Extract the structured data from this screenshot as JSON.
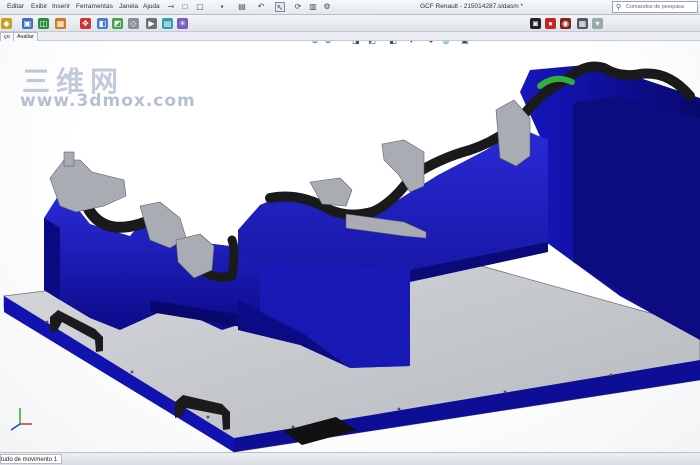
{
  "menubar": {
    "items": [
      "Editar",
      "Exibir",
      "Inserir",
      "Ferramentas",
      "Janela",
      "Ajuda"
    ],
    "window_title": "GCF Renault - 215014287.sldasm *",
    "search_placeholder": "Comandos de pesquisa"
  },
  "tabs": {
    "left_tab": "ço",
    "avaliar": "Avaliar"
  },
  "watermark": {
    "chinese": "三维网",
    "url": "www.3dmox.com"
  },
  "bottom": {
    "motion_study_tab": "tudo de movimento 1"
  },
  "icons": {
    "view_toolbar": [
      "zoom-to-fit-icon",
      "zoom-area-icon",
      "previous-view-icon",
      "section-view-icon",
      "view-orientation-icon",
      "display-style-icon",
      "hide-show-icon",
      "edit-appearance-icon",
      "apply-scene-icon",
      "view-settings-icon"
    ]
  },
  "colors": {
    "fixture_blue": "#1010b0",
    "base_plate": "#c8cace",
    "hose_black": "#1a1a1a",
    "clamp_grey": "#a9adb3"
  }
}
